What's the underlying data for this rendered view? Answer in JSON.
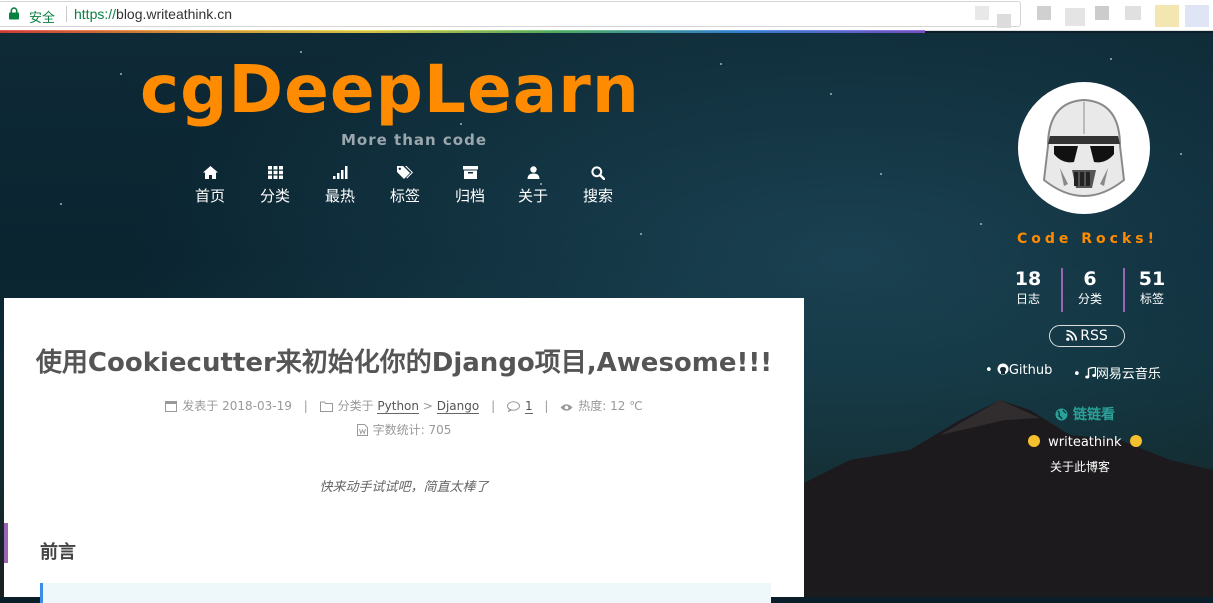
{
  "browser": {
    "secure_label": "安全",
    "url_scheme": "https://",
    "url_host": "blog.writeathink.cn"
  },
  "header": {
    "site_title": "cgDeepLearn",
    "subtitle": "More than code",
    "nav": [
      {
        "label": "首页",
        "icon": "home-icon"
      },
      {
        "label": "分类",
        "icon": "th-icon"
      },
      {
        "label": "最热",
        "icon": "signal-icon"
      },
      {
        "label": "标签",
        "icon": "tags-icon"
      },
      {
        "label": "归档",
        "icon": "archive-icon"
      },
      {
        "label": "关于",
        "icon": "user-icon"
      },
      {
        "label": "搜索",
        "icon": "search-icon"
      }
    ]
  },
  "post": {
    "title": "使用Cookiecutter来初始化你的Django项目,Awesome!!!",
    "posted_label": "发表于",
    "posted_date": "2018-03-19",
    "category_label": "分类于",
    "category_1": "Python",
    "category_arrow": ">",
    "category_2": "Django",
    "comments": "1",
    "heat_label": "热度:",
    "heat_value": "12 ℃",
    "wordcount_label": "字数统计:",
    "wordcount_value": "705",
    "quote": "快来动手试试吧，简直太棒了",
    "section_title": "前言"
  },
  "sidebar": {
    "slogan": "Code Rocks!",
    "stats": [
      {
        "num": "18",
        "label": "日志"
      },
      {
        "num": "6",
        "label": "分类"
      },
      {
        "num": "51",
        "label": "标签"
      }
    ],
    "rss_label": "RSS",
    "links": [
      {
        "label": "Github",
        "icon": "github-icon"
      },
      {
        "label": "网易云音乐",
        "icon": "music-icon"
      }
    ],
    "blogroll_title": "链链看",
    "blogroll_item": "writeathink",
    "about_blog": "关于此博客"
  },
  "colors": {
    "brand_orange": "#ff8c00",
    "accent_purple": "#9c65b3",
    "blogroll_teal": "#2aa198"
  }
}
